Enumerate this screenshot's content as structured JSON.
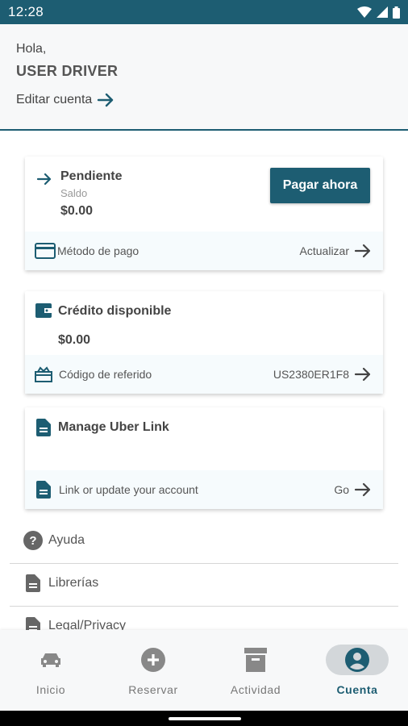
{
  "status_bar": {
    "time": "12:28"
  },
  "header": {
    "greeting": "Hola,",
    "user_name": "USER DRIVER",
    "edit_label": "Editar cuenta"
  },
  "pending_card": {
    "title": "Pendiente",
    "subtitle": "Saldo",
    "amount": "$0.00",
    "pay_button": "Pagar ahora",
    "footer_label": "Método de pago",
    "footer_action": "Actualizar"
  },
  "credit_card": {
    "title": "Crédito disponible",
    "amount": "$0.00",
    "footer_label": "Código de referido",
    "footer_action": "US2380ER1F8"
  },
  "link_card": {
    "title": "Manage Uber Link",
    "footer_label": "Link or update your account",
    "footer_action": "Go"
  },
  "menu": {
    "items": [
      {
        "label": "Ayuda",
        "icon": "help-circle-icon"
      },
      {
        "label": "Librerías",
        "icon": "document-icon"
      },
      {
        "label": "Legal/Privacy",
        "icon": "document-icon"
      }
    ]
  },
  "bottom_nav": {
    "items": [
      {
        "label": "Inicio",
        "icon": "car-icon"
      },
      {
        "label": "Reservar",
        "icon": "add-circle-icon"
      },
      {
        "label": "Actividad",
        "icon": "archive-icon"
      },
      {
        "label": "Cuenta",
        "icon": "account-circle-icon"
      }
    ],
    "active_index": 3
  },
  "colors": {
    "primary": "#1d5d72",
    "card_footer_bg": "#f6fbfd",
    "nav_bg": "#f7f8f9"
  }
}
